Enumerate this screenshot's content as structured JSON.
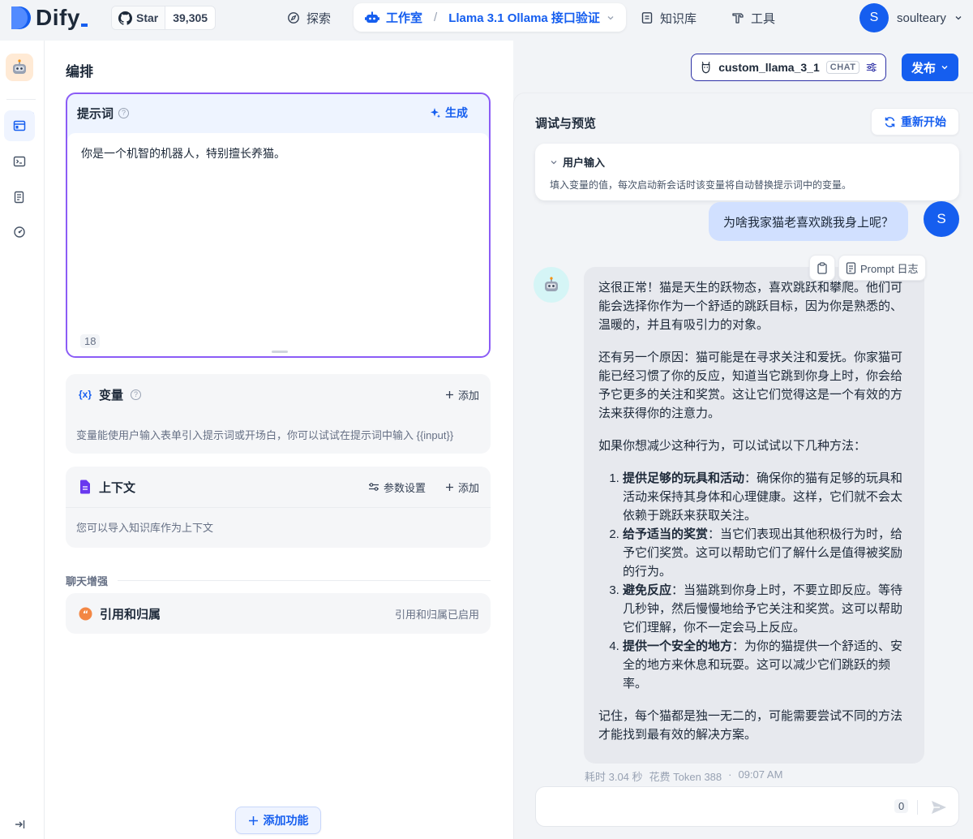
{
  "header": {
    "logo_text": "Dify",
    "github": {
      "star_label": "Star",
      "star_count": "39,305"
    },
    "nav": {
      "explore": "探索",
      "studio": "工作室",
      "app_name": "Llama 3.1 Ollama 接口验证",
      "knowledge": "知识库",
      "tools": "工具"
    },
    "user": {
      "initial": "S",
      "name": "soulteary"
    }
  },
  "orchestrate": {
    "title": "编排",
    "prompt": {
      "label": "提示词",
      "generate_label": "生成",
      "text": "你是一个机智的机器人，特别擅长养猫。",
      "char_count": "18"
    },
    "variables": {
      "icon_text": "{x}",
      "title": "变量",
      "add_label": "添加",
      "description": "变量能使用户输入表单引入提示词或开场白，你可以试试在提示词中输入 {{input}}"
    },
    "context": {
      "title": "上下文",
      "params_label": "参数设置",
      "add_label": "添加",
      "description": "您可以导入知识库作为上下文"
    },
    "chat_enhance": {
      "label": "聊天增强",
      "citation_title": "引用和归属",
      "citation_status": "引用和归属已启用"
    },
    "add_feature_label": "添加功能"
  },
  "model": {
    "name": "custom_llama_3_1",
    "tag": "CHAT"
  },
  "publish_label": "发布",
  "debug": {
    "title": "调试与预览",
    "restart_label": "重新开始",
    "user_input": {
      "title": "用户输入",
      "description": "填入变量的值，每次启动新会话时该变量将自动替换提示词中的变量。"
    },
    "question": "为啥我家猫老喜欢跳我身上呢？",
    "user_initial": "S",
    "answer_tools": {
      "prompt_log_label": "Prompt 日志"
    },
    "answer": {
      "p1": "这很正常！猫是天生的跃物态，喜欢跳跃和攀爬。他们可能会选择你作为一个舒适的跳跃目标，因为你是熟悉的、温暖的，并且有吸引力的对象。",
      "p2": "还有另一个原因：猫可能是在寻求关注和爱抚。你家猫可能已经习惯了你的反应，知道当它跳到你身上时，你会给予它更多的关注和奖赏。这让它们觉得这是一个有效的方法来获得你的注意力。",
      "p3": "如果你想减少这种行为，可以试试以下几种方法：",
      "items": [
        {
          "bold": "提供足够的玩具和活动",
          "text": "：确保你的猫有足够的玩具和活动来保持其身体和心理健康。这样，它们就不会太依赖于跳跃来获取关注。"
        },
        {
          "bold": "给予适当的奖赏",
          "text": "：当它们表现出其他积极行为时，给予它们奖赏。这可以帮助它们了解什么是值得被奖励的行为。"
        },
        {
          "bold": "避免反应",
          "text": "：当猫跳到你身上时，不要立即反应。等待几秒钟，然后慢慢地给予它关注和奖赏。这可以帮助它们理解，你不一定会马上反应。"
        },
        {
          "bold": "提供一个安全的地方",
          "text": "：为你的猫提供一个舒适的、安全的地方来休息和玩耍。这可以减少它们跳跃的频率。"
        }
      ],
      "p4": "记住，每个猫都是独一无二的，可能需要尝试不同的方法才能找到最有效的解决方案。"
    },
    "meta": {
      "time": "耗时 3.04 秒",
      "tokens": "花费 Token 388",
      "dot": "·",
      "clock": "09:07 AM"
    },
    "input": {
      "value": "",
      "count": "0"
    }
  }
}
